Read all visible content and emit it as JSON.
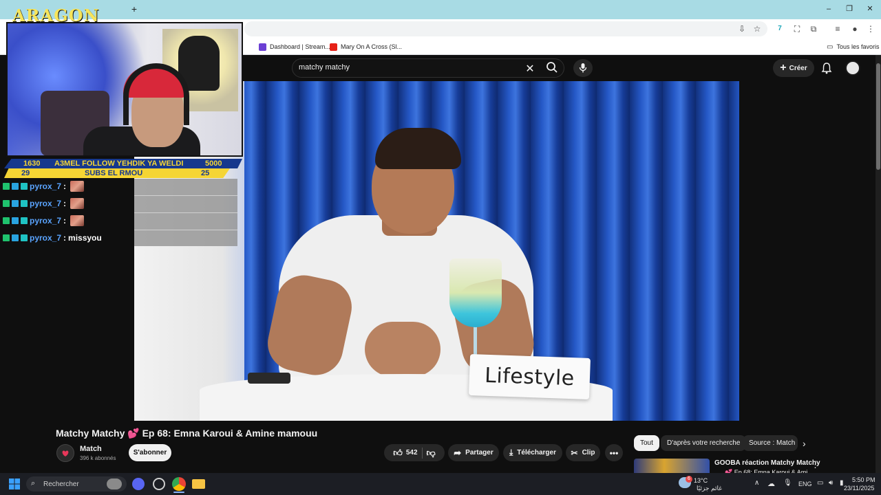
{
  "browser": {
    "bookmarks": [
      {
        "label": "Dashboard | Stream...",
        "color": "#6b3fd4"
      },
      {
        "label": "Mary On A Cross (Sl...",
        "color": "#e62117"
      }
    ],
    "all_favorites": "Tous les favoris",
    "extension_badge": "7"
  },
  "youtube": {
    "search_query": "matchy matchy",
    "create_label": "Créer",
    "video": {
      "sign_text": "Lifestyle"
    },
    "title": "Matchy Matchy 💕 Ep 68: Emna Karoui & Amine mamouu",
    "channel": {
      "name": "Match",
      "subscribers": "396 k abonnés",
      "subscribe_label": "S'abonner"
    },
    "actions": {
      "likes": "542",
      "share": "Partager",
      "download": "Télécharger",
      "clip": "Clip"
    },
    "chips": [
      "Tout",
      "D'après votre recherche",
      "Source : Match"
    ],
    "recommendation": {
      "title": "GOOBA réaction Matchy Matchy",
      "subtitle": "💕 Ep 68: Emna Karoui & Ami..."
    }
  },
  "overlay": {
    "logo": "ARAGON",
    "bar1": {
      "left": "1630",
      "text": "A3MEL FOLLOW YEHDIK YA WELDI",
      "right": "5000"
    },
    "bar2": {
      "left": "29",
      "text": "SUBS EL RMOU",
      "right": "25"
    },
    "chat": [
      {
        "user": "pyrox_7",
        "message": "",
        "emote": true
      },
      {
        "user": "pyrox_7",
        "message": "",
        "emote": true
      },
      {
        "user": "pyrox_7",
        "message": "",
        "emote": true
      },
      {
        "user": "pyrox_7",
        "message": "missyou",
        "emote": false
      }
    ]
  },
  "taskbar": {
    "search_placeholder": "Rechercher",
    "weather_temp": "13°C",
    "weather_desc": "غائم جزئيًا",
    "notification_count": "6",
    "language": "ENG",
    "time": "5:50 PM",
    "date": "23/11/2025"
  },
  "colors": {
    "youtube_bg": "#0f0f0f",
    "tab_strip": "#a8dbe4",
    "overlay_yellow": "#f5d534",
    "overlay_blue": "#16388d",
    "chat_username": "#5aa4ff"
  }
}
